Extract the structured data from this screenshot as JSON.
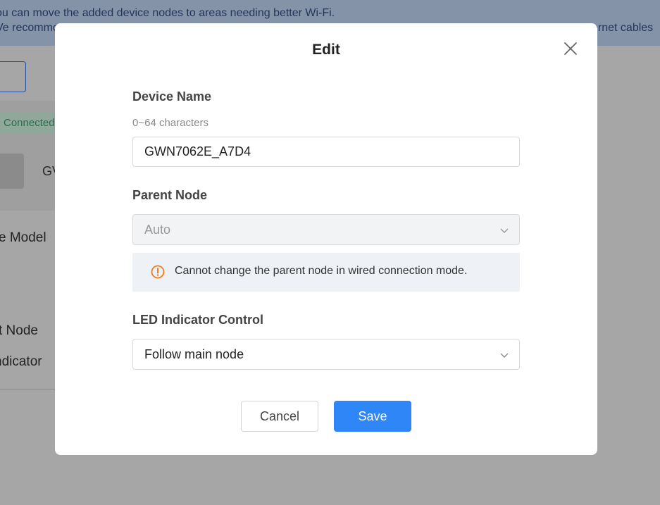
{
  "background": {
    "banner_line_1": "ou can move the added device nodes to areas needing better Wi-Fi.",
    "banner_line_2_left": "Ve recommo",
    "banner_line_2_right": "ernet cables",
    "status_badge": "Connected",
    "device_name_partial": "GV",
    "label_model": "e Model",
    "label_node": "t Node",
    "label_indicator": "ndicator"
  },
  "modal": {
    "title": "Edit",
    "device_name": {
      "label": "Device Name",
      "hint": "0~64 characters",
      "value": "GWN7062E_A7D4"
    },
    "parent_node": {
      "label": "Parent Node",
      "value": "Auto",
      "notice": "Cannot change the parent node in wired connection mode."
    },
    "led_control": {
      "label": "LED Indicator Control",
      "value": "Follow main node"
    },
    "buttons": {
      "cancel": "Cancel",
      "save": "Save"
    }
  },
  "colors": {
    "primary": "#2f86f6",
    "warning": "#f07b1f",
    "overlay": "#a6a6a6"
  }
}
